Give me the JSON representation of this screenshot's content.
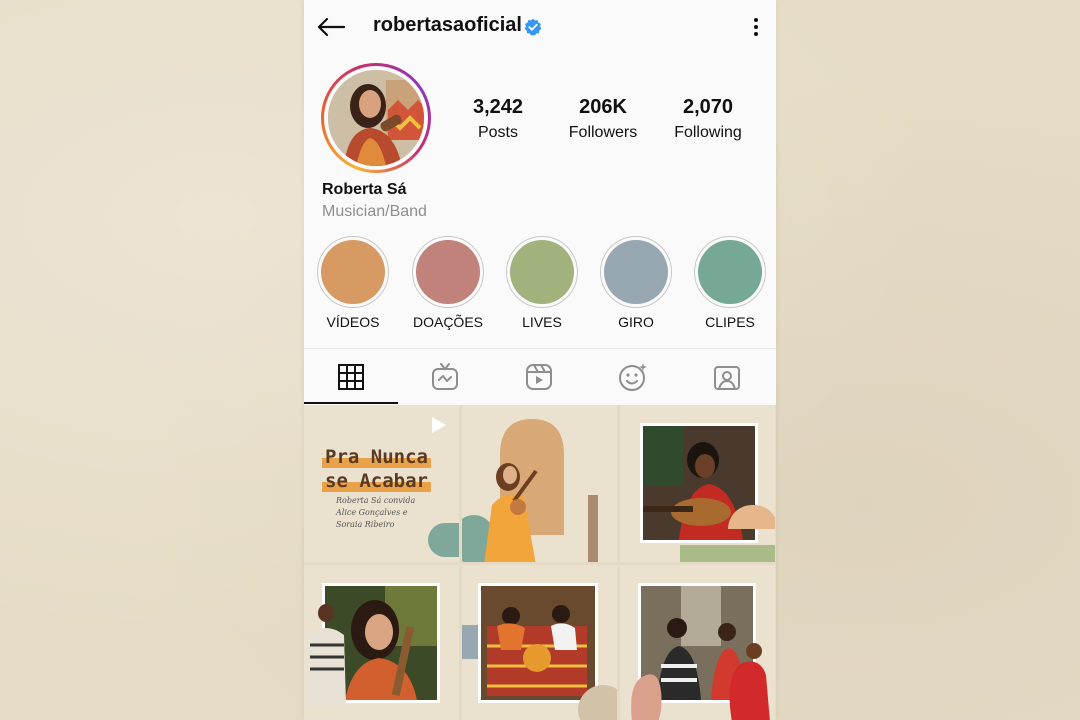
{
  "header": {
    "username": "robertasaoficial"
  },
  "profile": {
    "name": "Roberta Sá",
    "category": "Musician/Band",
    "stats": [
      {
        "value": "3,242",
        "label": "Posts"
      },
      {
        "value": "206K",
        "label": "Followers"
      },
      {
        "value": "2,070",
        "label": "Following"
      }
    ]
  },
  "highlights": [
    {
      "label": "VÍDEOS",
      "color": "#d69a62"
    },
    {
      "label": "DOAÇÕES",
      "color": "#c0827a"
    },
    {
      "label": "LIVES",
      "color": "#a1b27c"
    },
    {
      "label": "GIRO",
      "color": "#98a8b3"
    },
    {
      "label": "CLIPES",
      "color": "#76a896"
    }
  ],
  "tabs": [
    {
      "icon": "grid-icon",
      "active": true
    },
    {
      "icon": "igtv-icon",
      "active": false
    },
    {
      "icon": "reels-icon",
      "active": false
    },
    {
      "icon": "effects-icon",
      "active": false
    },
    {
      "icon": "tagged-icon",
      "active": false
    }
  ],
  "posts": {
    "first": {
      "title_line1": "Pra Nunca",
      "title_line2": "se Acabar",
      "subtitle_line1": "Roberta Sá convida",
      "subtitle_line2": "Alice Gonçalves e",
      "subtitle_line3": "Soraia Ribeiro"
    }
  },
  "colors": {
    "accent_verified": "#3897f0",
    "text": "#111111",
    "secondary_text": "#8e8e8e",
    "background": "#fafafa",
    "page_background": "#e6dcc6"
  }
}
